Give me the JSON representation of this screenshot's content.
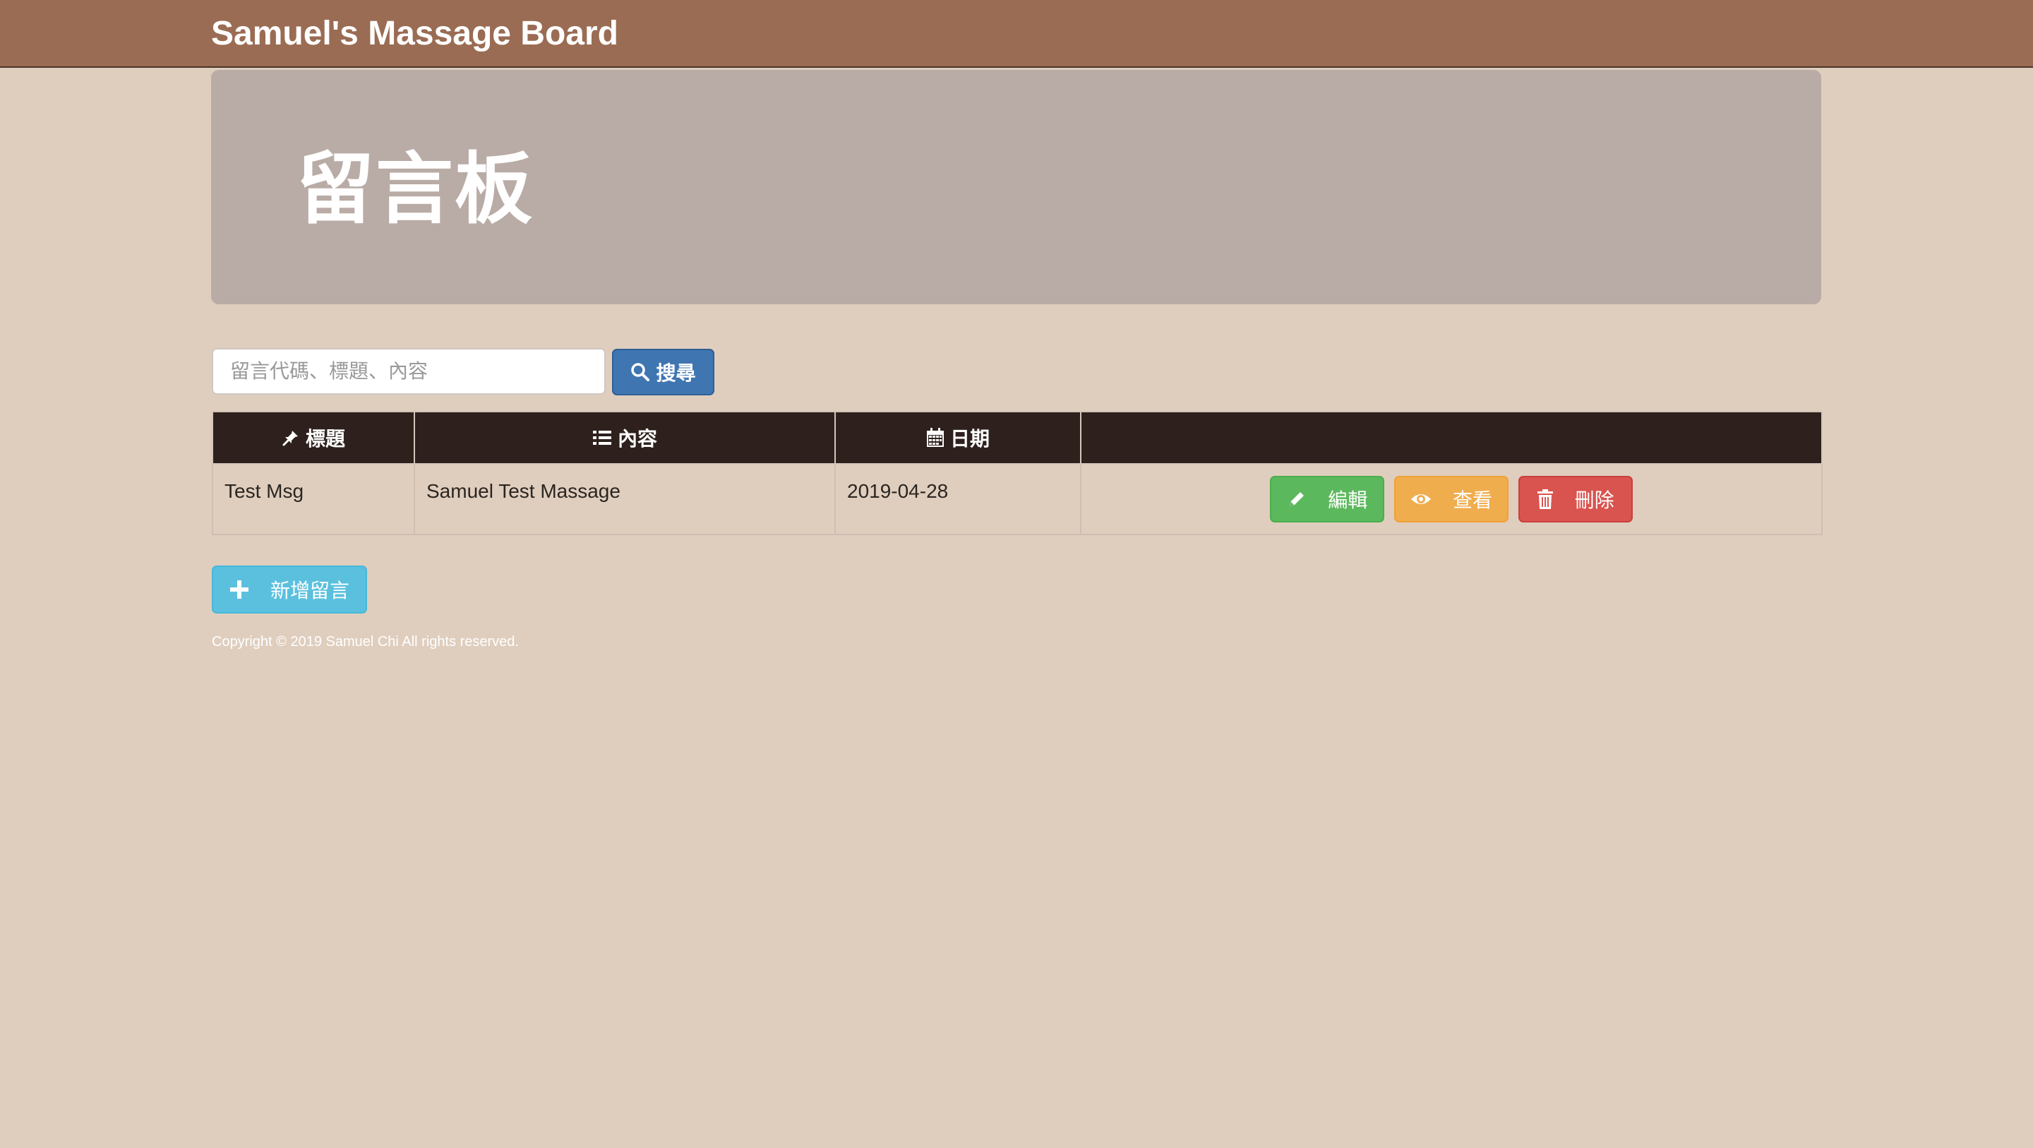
{
  "navbar": {
    "brand": "Samuel's Massage Board"
  },
  "jumbotron": {
    "title": "留言板"
  },
  "search": {
    "placeholder": "留言代碼、標題、內容",
    "button_label": "搜尋",
    "button_icon": "search-icon"
  },
  "table": {
    "headers": [
      {
        "label": "標題",
        "icon": "pushpin-icon"
      },
      {
        "label": "內容",
        "icon": "list-icon"
      },
      {
        "label": "日期",
        "icon": "calendar-icon"
      },
      {
        "label": ""
      }
    ],
    "rows": [
      {
        "title": "Test Msg",
        "content": "Samuel Test Massage",
        "date": "2019-04-28",
        "actions": {
          "edit_label": "編輯",
          "view_label": "查看",
          "delete_label": "刪除"
        }
      }
    ]
  },
  "add_button": {
    "label": "新增留言",
    "icon": "plus-icon"
  },
  "footer": {
    "copyright": "Copyright © 2019 Samuel Chi All rights reserved."
  },
  "colors": {
    "page_background": "#dfcebe",
    "navbar": "#9a6c53",
    "jumbotron": "#b9aba5",
    "table_header": "#2e211d",
    "primary": "#3f75b1",
    "success": "#5cb85c",
    "warning": "#f0ad4e",
    "danger": "#d9534f",
    "info": "#5bc0de"
  }
}
